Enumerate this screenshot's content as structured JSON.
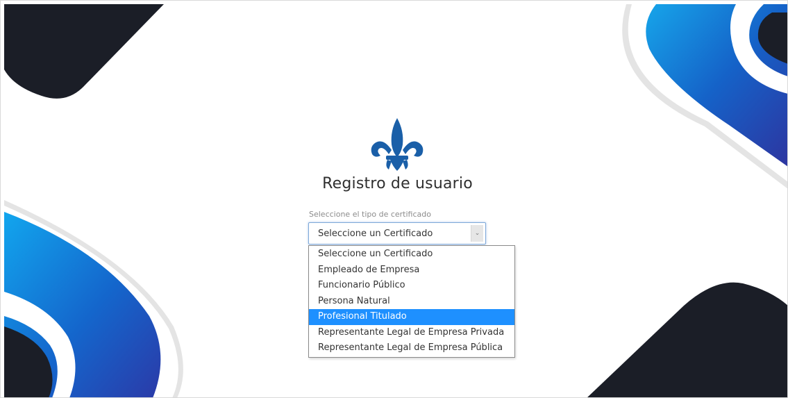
{
  "page": {
    "title": "Registro de usuario",
    "brand_color": "#1a5fa8",
    "logo_icon": "fleur-de-lis-icon"
  },
  "form": {
    "certificate_label": "Seleccione el tipo de certificado",
    "certificate_select": {
      "value": "Seleccione un Certificado",
      "options": [
        "Seleccione un Certificado",
        "Empleado de Empresa",
        "Funcionario Público",
        "Persona Natural",
        "Profesional Titulado",
        "Representante Legal de Empresa Privada",
        "Representante Legal de Empresa Pública"
      ],
      "highlighted_option": "Profesional Titulado",
      "highlight_color": "#1e90ff"
    }
  },
  "decor": {
    "dark_color": "#1b1e27",
    "blue_light": "#0d9ae6",
    "blue_deep": "#2a3aa6"
  }
}
